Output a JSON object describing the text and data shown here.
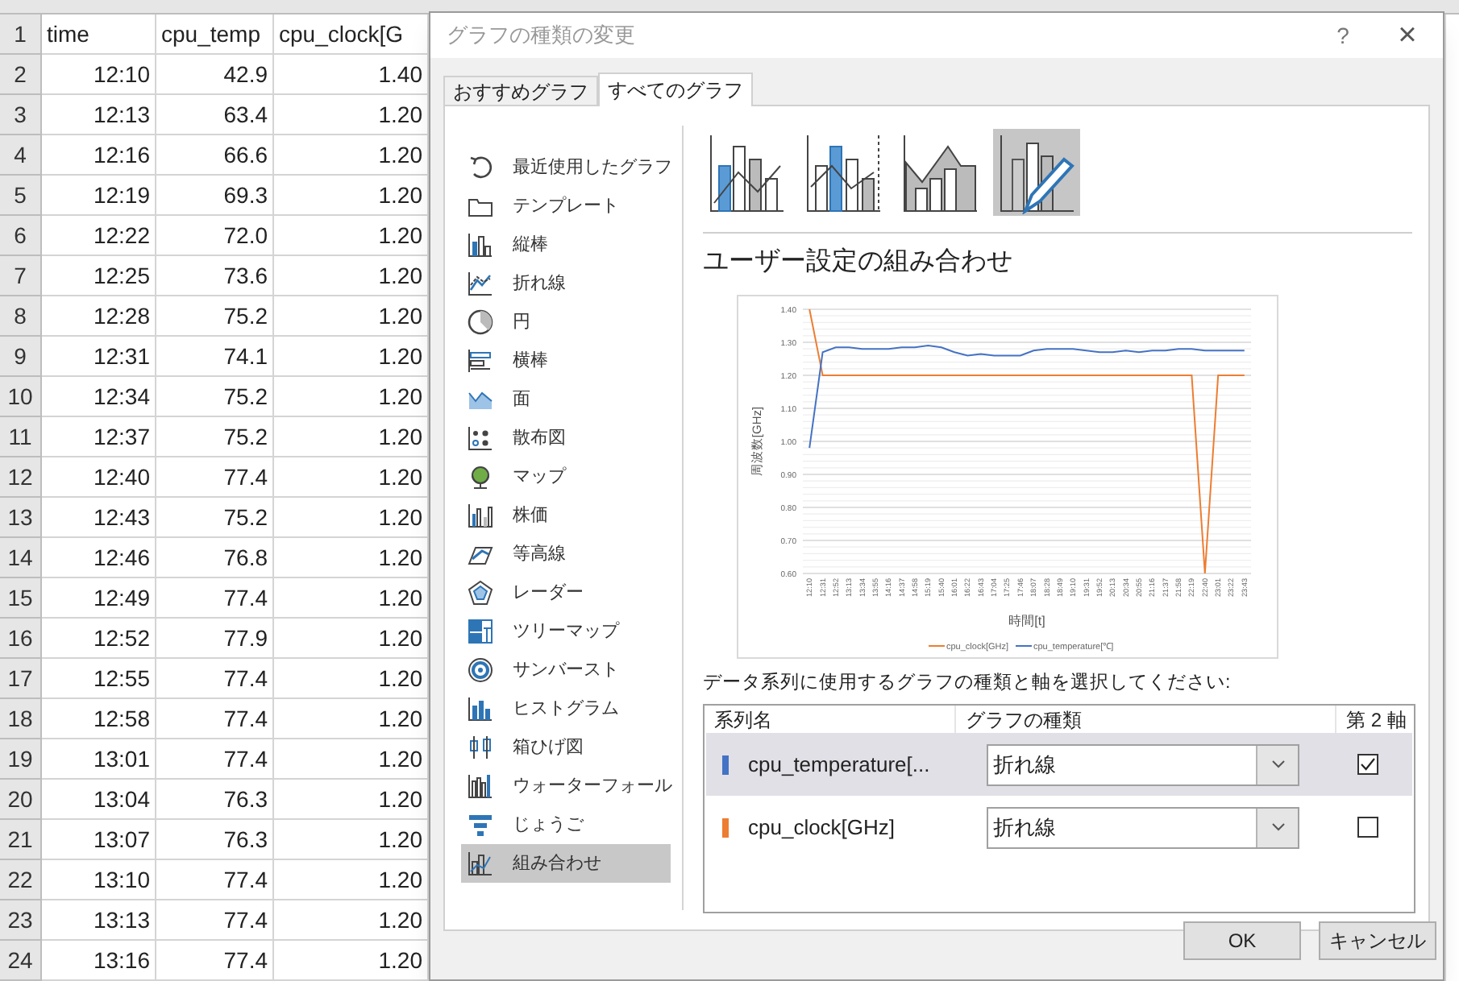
{
  "sheet": {
    "header": {
      "row": "1",
      "cells": [
        "time",
        "cpu_temp",
        "cpu_clock[G"
      ]
    },
    "rows": [
      {
        "row": "2",
        "cells": [
          "12:10",
          "42.9",
          "1.40"
        ]
      },
      {
        "row": "3",
        "cells": [
          "12:13",
          "63.4",
          "1.20"
        ]
      },
      {
        "row": "4",
        "cells": [
          "12:16",
          "66.6",
          "1.20"
        ]
      },
      {
        "row": "5",
        "cells": [
          "12:19",
          "69.3",
          "1.20"
        ]
      },
      {
        "row": "6",
        "cells": [
          "12:22",
          "72.0",
          "1.20"
        ]
      },
      {
        "row": "7",
        "cells": [
          "12:25",
          "73.6",
          "1.20"
        ]
      },
      {
        "row": "8",
        "cells": [
          "12:28",
          "75.2",
          "1.20"
        ]
      },
      {
        "row": "9",
        "cells": [
          "12:31",
          "74.1",
          "1.20"
        ]
      },
      {
        "row": "10",
        "cells": [
          "12:34",
          "75.2",
          "1.20"
        ]
      },
      {
        "row": "11",
        "cells": [
          "12:37",
          "75.2",
          "1.20"
        ]
      },
      {
        "row": "12",
        "cells": [
          "12:40",
          "77.4",
          "1.20"
        ]
      },
      {
        "row": "13",
        "cells": [
          "12:43",
          "75.2",
          "1.20"
        ]
      },
      {
        "row": "14",
        "cells": [
          "12:46",
          "76.8",
          "1.20"
        ]
      },
      {
        "row": "15",
        "cells": [
          "12:49",
          "77.4",
          "1.20"
        ]
      },
      {
        "row": "16",
        "cells": [
          "12:52",
          "77.9",
          "1.20"
        ]
      },
      {
        "row": "17",
        "cells": [
          "12:55",
          "77.4",
          "1.20"
        ]
      },
      {
        "row": "18",
        "cells": [
          "12:58",
          "77.4",
          "1.20"
        ]
      },
      {
        "row": "19",
        "cells": [
          "13:01",
          "77.4",
          "1.20"
        ]
      },
      {
        "row": "20",
        "cells": [
          "13:04",
          "76.3",
          "1.20"
        ]
      },
      {
        "row": "21",
        "cells": [
          "13:07",
          "76.3",
          "1.20"
        ]
      },
      {
        "row": "22",
        "cells": [
          "13:10",
          "77.4",
          "1.20"
        ]
      },
      {
        "row": "23",
        "cells": [
          "13:13",
          "77.4",
          "1.20"
        ]
      },
      {
        "row": "24",
        "cells": [
          "13:16",
          "77.4",
          "1.20"
        ]
      }
    ]
  },
  "dialog": {
    "title": "グラフの種類の変更",
    "help": "?",
    "close": "×",
    "tabs": [
      {
        "label": "おすすめグラフ",
        "selected": false
      },
      {
        "label": "すべてのグラフ",
        "selected": true
      }
    ],
    "sidebar": {
      "items": [
        {
          "label": "最近使用したグラフ",
          "selected": false
        },
        {
          "label": "テンプレート",
          "selected": false
        },
        {
          "label": "縦棒",
          "selected": false
        },
        {
          "label": "折れ線",
          "selected": false
        },
        {
          "label": "円",
          "selected": false
        },
        {
          "label": "横棒",
          "selected": false
        },
        {
          "label": "面",
          "selected": false
        },
        {
          "label": "散布図",
          "selected": false
        },
        {
          "label": "マップ",
          "selected": false
        },
        {
          "label": "株価",
          "selected": false
        },
        {
          "label": "等高線",
          "selected": false
        },
        {
          "label": "レーダー",
          "selected": false
        },
        {
          "label": "ツリーマップ",
          "selected": false
        },
        {
          "label": "サンバースト",
          "selected": false
        },
        {
          "label": "ヒストグラム",
          "selected": false
        },
        {
          "label": "箱ひげ図",
          "selected": false
        },
        {
          "label": "ウォーターフォール",
          "selected": false
        },
        {
          "label": "じょうご",
          "selected": false
        },
        {
          "label": "組み合わせ",
          "selected": true
        }
      ]
    },
    "subtypes": [
      {
        "selected": false
      },
      {
        "selected": false
      },
      {
        "selected": false
      },
      {
        "selected": true
      }
    ],
    "heading": "ユーザー設定の組み合わせ",
    "preview": {
      "chart_data": {
        "type": "line",
        "grid": true,
        "legend": "bottom",
        "xlabel": "時間[t]",
        "ylabel": "周波数[GHz]",
        "categories": [
          "12:10",
          "12:31",
          "12:52",
          "13:13",
          "13:34",
          "13:55",
          "14:16",
          "14:37",
          "14:58",
          "15:19",
          "15:40",
          "16:01",
          "16:22",
          "16:43",
          "17:04",
          "17:25",
          "17:46",
          "18:07",
          "18:28",
          "18:49",
          "19:10",
          "19:31",
          "19:52",
          "20:13",
          "20:34",
          "20:55",
          "21:16",
          "21:37",
          "21:58",
          "22:19",
          "22:40",
          "23:01",
          "23:22",
          "23:43"
        ],
        "ylim": [
          0.6,
          1.4
        ],
        "yticks": [
          {
            "value": 0.6,
            "label": "0.60"
          },
          {
            "value": 0.7,
            "label": "0.70"
          },
          {
            "value": 0.8,
            "label": "0.80"
          },
          {
            "value": 0.9,
            "label": "0.90"
          },
          {
            "value": 1.0,
            "label": "1.00"
          },
          {
            "value": 1.1,
            "label": "1.10"
          },
          {
            "value": 1.2,
            "label": "1.20"
          },
          {
            "value": 1.3,
            "label": "1.30"
          },
          {
            "value": 1.4,
            "label": "1.40"
          }
        ],
        "series": [
          {
            "name": "cpu_clock[GHz]",
            "color": "#ed7d31",
            "values": [
              1.4,
              1.2,
              1.2,
              1.2,
              1.2,
              1.2,
              1.2,
              1.2,
              1.2,
              1.2,
              1.2,
              1.2,
              1.2,
              1.2,
              1.2,
              1.2,
              1.2,
              1.2,
              1.2,
              1.2,
              1.2,
              1.2,
              1.2,
              1.2,
              1.2,
              1.2,
              1.2,
              1.2,
              1.2,
              1.2,
              0.6,
              1.2,
              1.2,
              1.2
            ]
          },
          {
            "name": "cpu_temperature[℃]",
            "color": "#4472c4",
            "values": [
              0.98,
              1.27,
              1.285,
              1.285,
              1.28,
              1.28,
              1.28,
              1.285,
              1.285,
              1.29,
              1.285,
              1.27,
              1.26,
              1.265,
              1.26,
              1.26,
              1.26,
              1.275,
              1.28,
              1.28,
              1.28,
              1.275,
              1.27,
              1.27,
              1.275,
              1.27,
              1.275,
              1.275,
              1.28,
              1.28,
              1.275,
              1.275,
              1.275,
              1.275
            ]
          }
        ]
      }
    },
    "instruction": "データ系列に使用するグラフの種類と軸を選択してください:",
    "series_table": {
      "columns": [
        "系列名",
        "グラフの種類",
        "第 2 軸"
      ],
      "rows": [
        {
          "name": "cpu_temperature[...",
          "color": "#4472c4",
          "chart_type": "折れ線",
          "secondary_axis": true,
          "selected": true
        },
        {
          "name": "cpu_clock[GHz]",
          "color": "#ed7d31",
          "chart_type": "折れ線",
          "secondary_axis": false,
          "selected": false
        }
      ]
    },
    "buttons": [
      "OK",
      "キャンセル"
    ]
  }
}
